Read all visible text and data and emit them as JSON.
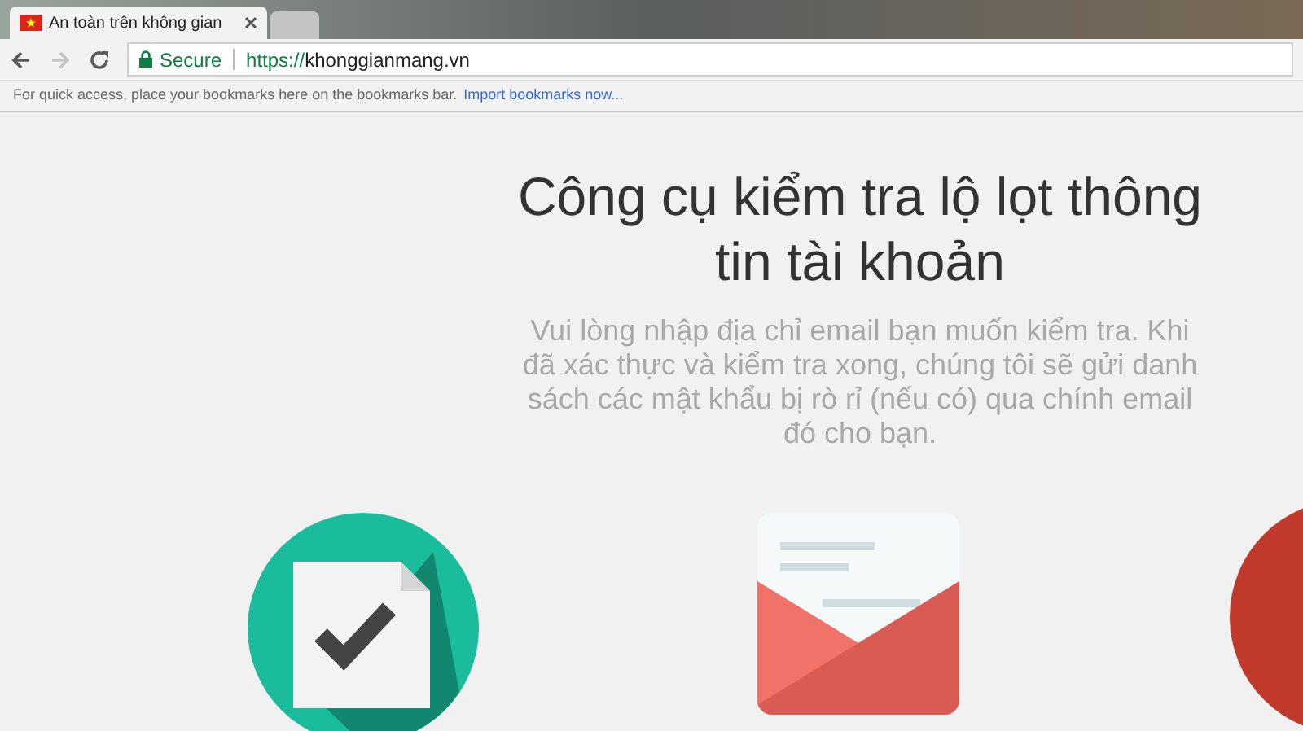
{
  "tabs": [
    {
      "title": "An toàn trên không gian",
      "selected": true
    },
    {
      "selected": false
    }
  ],
  "address_bar": {
    "secure_label": "Secure",
    "url_scheme": "https://",
    "url_host": "khonggianmang.vn"
  },
  "bookmarks_bar": {
    "hint": "For quick access, place your bookmarks here on the bookmarks bar.",
    "link": "Import bookmarks now..."
  },
  "page": {
    "heading": "Công cụ kiểm tra lộ lọt thông tin tài khoản",
    "description": "Vui lòng nhập địa chỉ email bạn muốn kiểm tra. Khi đã xác thực và kiểm tra xong, chúng tôi sẽ gửi danh sách các mật khẩu bị rò rỉ (nếu có) qua chính email đó cho bạn."
  }
}
